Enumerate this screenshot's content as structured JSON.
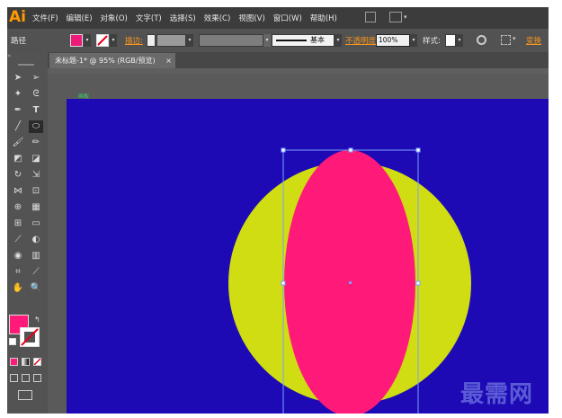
{
  "app": {
    "logo": "Ai"
  },
  "menu": [
    "文件(F)",
    "编辑(E)",
    "对象(O)",
    "文字(T)",
    "选择(S)",
    "效果(C)",
    "视图(V)",
    "窗口(W)",
    "帮助(H)"
  ],
  "control_bar": {
    "path_label": "路径",
    "stroke_label": "描边:",
    "brush_value": "基本",
    "opacity_label": "不透明度",
    "opacity_value": "100%",
    "style_label": "样式:",
    "transform_label": "变换",
    "fill_color": "#ee1a7a"
  },
  "document": {
    "tab_title": "未标题-1* @ 95% (RGB/预览)",
    "tab_close": "×",
    "artboard_label": "画板",
    "canvas_color": "#1e0ab5"
  },
  "artwork": {
    "circle_color": "#cfdd12",
    "ellipse_color": "#ff1a7a",
    "selection_color": "#7aa0ff"
  },
  "tools": {
    "fill_color": "#ff1a7a",
    "stroke_label": "描边"
  },
  "watermark": "最需网"
}
